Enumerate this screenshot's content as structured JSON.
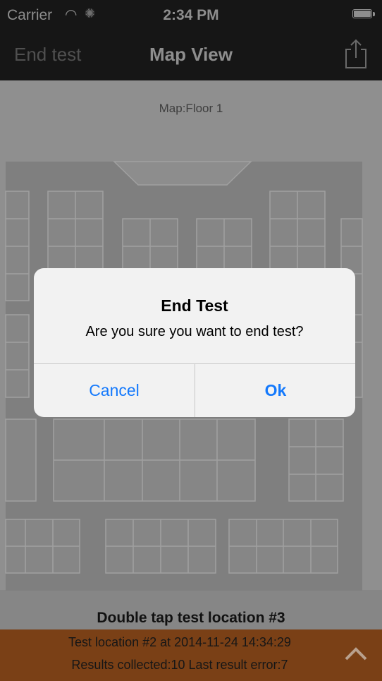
{
  "status_bar": {
    "carrier": "Carrier",
    "time": "2:34 PM"
  },
  "nav": {
    "left_button": "End test",
    "title": "Map View"
  },
  "map": {
    "label": "Map:Floor 1"
  },
  "hint": "Double tap test location #3",
  "bottom_bar": {
    "location_status": "Test location #2 at 2014-11-24 14:34:29",
    "results_status": "Results collected:10   Last result error:7"
  },
  "alert": {
    "title": "End Test",
    "message": "Are you sure you want to end test?",
    "cancel_label": "Cancel",
    "ok_label": "Ok"
  },
  "colors": {
    "accent": "#1479fc",
    "bottom_bar": "#7a4016",
    "nav_bar": "#161616"
  }
}
